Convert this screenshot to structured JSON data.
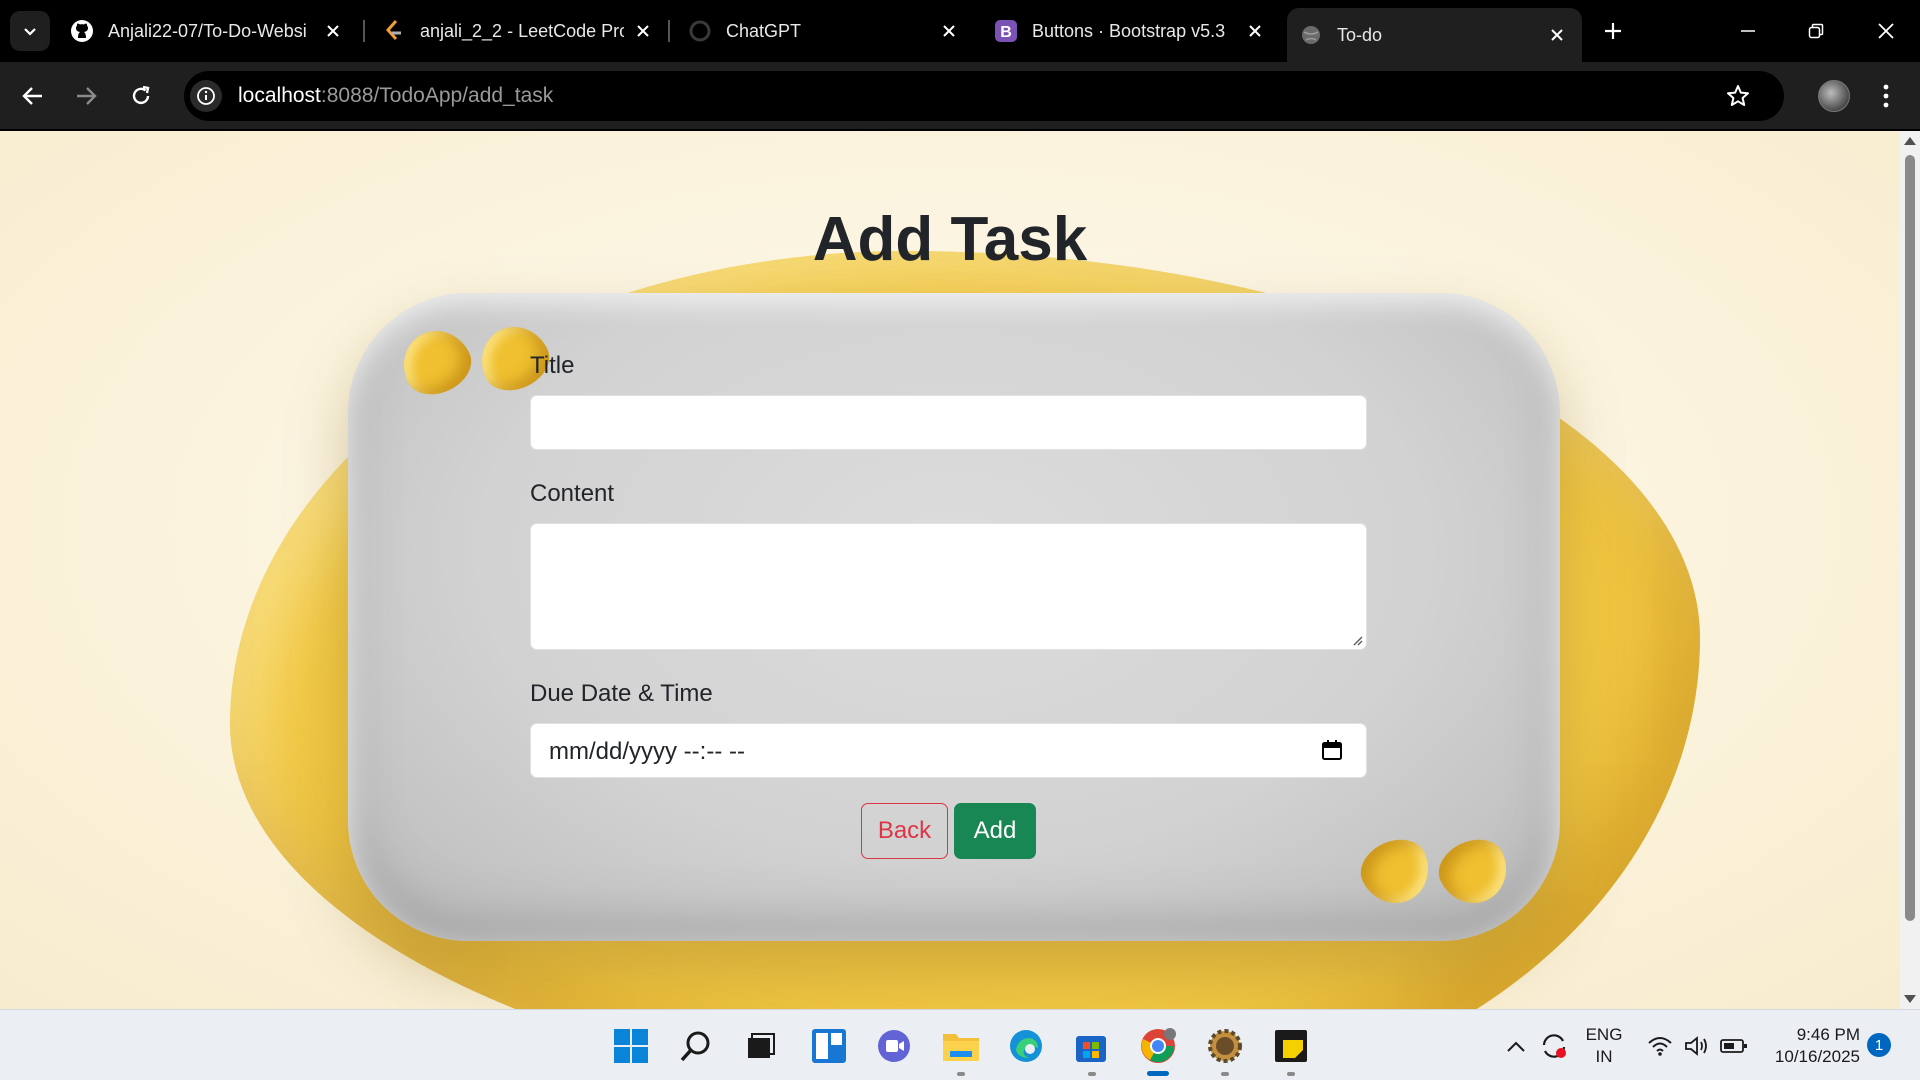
{
  "browser": {
    "tabs": [
      {
        "title": "Anjali22-07/To-Do-Websi",
        "icon": "github-icon"
      },
      {
        "title": "anjali_2_2 - LeetCode Pro",
        "icon": "leetcode-icon"
      },
      {
        "title": "ChatGPT",
        "icon": "chatgpt-icon"
      },
      {
        "title": "Buttons · Bootstrap v5.3",
        "icon": "bootstrap-icon"
      },
      {
        "title": "To-do",
        "icon": "globe-icon",
        "active": true
      }
    ],
    "url_host": "localhost",
    "url_rest": ":8088/TodoApp/add_task"
  },
  "page": {
    "heading": "Add Task",
    "title_label": "Title",
    "title_value": "",
    "content_label": "Content",
    "content_value": "",
    "due_label": "Due Date & Time",
    "due_placeholder": "mm/dd/yyyy --:-- --",
    "back_button": "Back",
    "add_button": "Add"
  },
  "colors": {
    "back_button": "#dc3545",
    "add_button": "#198754",
    "heading": "#212529"
  },
  "taskbar": {
    "lang_line1": "ENG",
    "lang_line2": "IN",
    "time": "9:46 PM",
    "date": "10/16/2025",
    "notification_count": "1"
  }
}
